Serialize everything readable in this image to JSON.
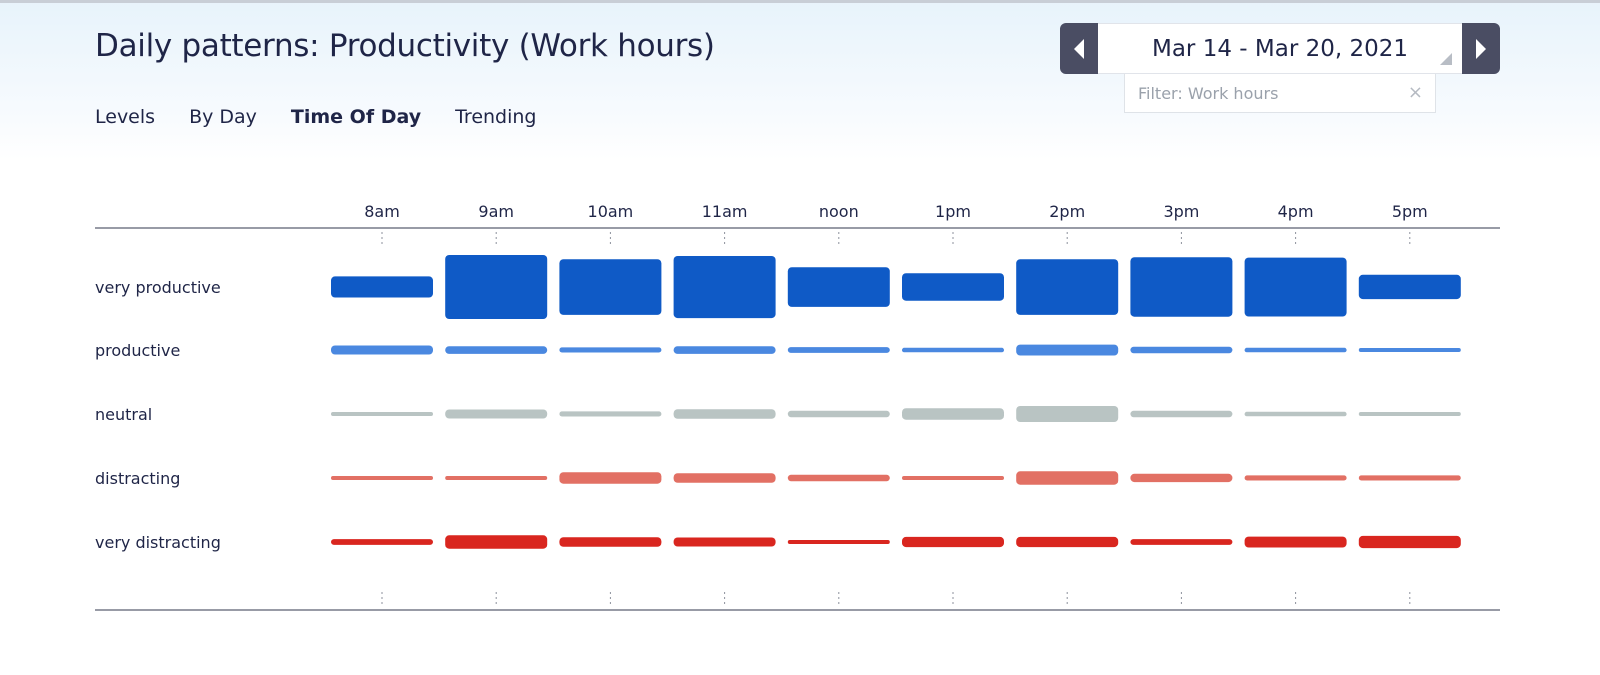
{
  "page": {
    "title": "Daily patterns: Productivity (Work hours)"
  },
  "tabs": [
    {
      "label": "Levels",
      "active": false
    },
    {
      "label": "By Day",
      "active": false
    },
    {
      "label": "Time Of Day",
      "active": true
    },
    {
      "label": "Trending",
      "active": false
    }
  ],
  "date_nav": {
    "range_label": "Mar 14 - Mar 20, 2021",
    "prev_icon": "triangle-left-icon",
    "next_icon": "triangle-right-icon"
  },
  "filter": {
    "label": "Filter: Work hours",
    "clear_icon": "close-icon",
    "clear_glyph": "×"
  },
  "colors": {
    "very_productive": "#0f5ac6",
    "productive": "#4a88e0",
    "neutral": "#b9c4c3",
    "distracting": "#e27064",
    "very_distracting": "#d9261f",
    "nav_button": "#4a4d63"
  },
  "chart_data": {
    "type": "heatmap",
    "hours": [
      "8am",
      "9am",
      "10am",
      "11am",
      "noon",
      "1pm",
      "2pm",
      "3pm",
      "4pm",
      "5pm"
    ],
    "rows": [
      {
        "key": "very_productive",
        "label": "very productive",
        "values": [
          0.33,
          1.0,
          0.87,
          0.97,
          0.62,
          0.43,
          0.87,
          0.93,
          0.92,
          0.38
        ]
      },
      {
        "key": "productive",
        "label": "productive",
        "values": [
          0.14,
          0.12,
          0.08,
          0.12,
          0.09,
          0.07,
          0.17,
          0.1,
          0.07,
          0.04
        ]
      },
      {
        "key": "neutral",
        "label": "neutral",
        "values": [
          0.05,
          0.14,
          0.08,
          0.15,
          0.1,
          0.18,
          0.25,
          0.1,
          0.07,
          0.04
        ]
      },
      {
        "key": "distracting",
        "label": "distracting",
        "values": [
          0.06,
          0.06,
          0.18,
          0.15,
          0.1,
          0.06,
          0.21,
          0.13,
          0.08,
          0.08
        ]
      },
      {
        "key": "very_distracting",
        "label": "very distracting",
        "values": [
          0.09,
          0.21,
          0.15,
          0.14,
          0.06,
          0.16,
          0.16,
          0.09,
          0.17,
          0.19
        ]
      }
    ],
    "legend": "none",
    "grid": false
  }
}
